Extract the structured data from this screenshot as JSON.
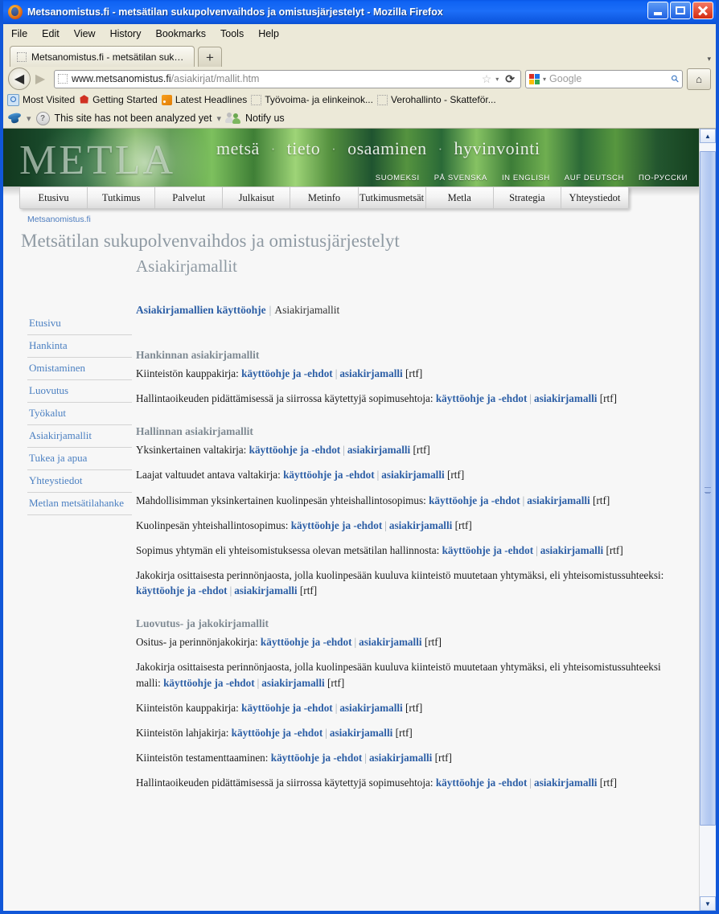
{
  "window": {
    "title": "Metsanomistus.fi - metsätilan sukupolvenvaihdos ja omistusjärjestelyt - Mozilla Firefox",
    "minimize_label": "Minimize",
    "maximize_label": "Maximize",
    "close_label": "Close"
  },
  "menubar": [
    "File",
    "Edit",
    "View",
    "History",
    "Bookmarks",
    "Tools",
    "Help"
  ],
  "tabs": {
    "active_tab_label": "Metsanomistus.fi - metsätilan suku...",
    "new_tab_label": "+",
    "tab_list_label": "▾"
  },
  "navbar": {
    "back_label": "◀",
    "forward_label": "▶",
    "url_main": "www.metsanomistus.fi",
    "url_path": "/asiakirjat/mallit.htm",
    "star_label": "☆",
    "star_caret": "▾",
    "reload_label": "⟳",
    "search_caret": "▾",
    "search_placeholder": "Google",
    "magnifier_label": "⚲",
    "home_label": "⌂"
  },
  "bookmarks": [
    {
      "label": "Most Visited",
      "icon": "most-visited-icon"
    },
    {
      "label": "Getting Started",
      "icon": "getting-started-icon"
    },
    {
      "label": "Latest Headlines",
      "icon": "rss-icon"
    },
    {
      "label": "Työvoima- ja elinkeinok...",
      "icon": "generic-bookmark-icon"
    },
    {
      "label": "Verohallinto - Skatteför...",
      "icon": "generic-bookmark-icon"
    }
  ],
  "statusbar": {
    "wot_caret": "▾",
    "message": "This site has not been analyzed yet",
    "separator": "▾",
    "notify_label": "Notify us"
  },
  "banner": {
    "logo": "METLA",
    "slogan_words": [
      "metsä",
      "tieto",
      "osaaminen",
      "hyvinvointi"
    ],
    "slogan_separator": "·",
    "languages": [
      "SUOMEKSI",
      "PÅ SVENSKA",
      "IN ENGLISH",
      "AUF DEUTSCH",
      "ПО-РУССКИ"
    ]
  },
  "sitenav": [
    "Etusivu",
    "Tutkimus",
    "Palvelut",
    "Julkaisut",
    "Metinfo",
    "Tutkimusmetsät",
    "Metla",
    "Strategia",
    "Yhteystiedot"
  ],
  "breadcrumb": "Metsanomistus.fi",
  "page_title": "Metsätilan sukupolvenvaihdos ja omistusjärjestelyt",
  "sidebar": {
    "items": [
      "Etusivu",
      "Hankinta",
      "Omistaminen",
      "Luovutus",
      "Työkalut",
      "Asiakirjamallit",
      "Tukea ja apua",
      "Yhteystiedot",
      "Metlan metsätilahanke"
    ]
  },
  "main": {
    "section_title": "Asiakirjamallit",
    "crumb": {
      "link": "Asiakirjamallien käyttöohje",
      "separator": "|",
      "current": "Asiakirjamallit"
    },
    "link_guide": "käyttöohje ja -ehdot",
    "link_model": "asiakirjamalli",
    "link_model_plural": "asiakirjamalli",
    "format": "[rtf]",
    "pipe": "|",
    "groups": [
      {
        "title": "Hankinnan asiakirjamallit",
        "documents": [
          {
            "label": "Kiinteistön kauppakirja:",
            "guide": "käyttöohje ja -ehdot",
            "model": "asiakirjamalli",
            "format": "[rtf]"
          },
          {
            "label": "Hallintaoikeuden pidättämisessä ja siirrossa käytettyjä sopimusehtoja:",
            "guide": "käyttöohje ja -ehdot",
            "model": "asiakirjamalli",
            "format": "[rtf]"
          }
        ]
      },
      {
        "title": "Hallinnan asiakirjamallit",
        "documents": [
          {
            "label": "Yksinkertainen valtakirja:",
            "guide": "käyttöohje ja -ehdot",
            "model": "asiakirjamalli",
            "format": "[rtf]"
          },
          {
            "label": "Laajat valtuudet antava valtakirja:",
            "guide": "käyttöohje ja -ehdot",
            "model": "asiakirjamalli",
            "format": "[rtf]"
          },
          {
            "label": "Mahdollisimman yksinkertainen kuolinpesän yhteishallintosopimus:",
            "guide": "käyttöohje ja -ehdot",
            "model": "asiakirjamalli",
            "format": "[rtf]"
          },
          {
            "label": "Kuolinpesän yhteishallintosopimus:",
            "guide": "käyttöohje ja -ehdot",
            "model": "asiakirjamalli",
            "format": "[rtf]"
          },
          {
            "label": "Sopimus yhtymän eli yhteisomistuksessa olevan metsätilan hallinnosta:",
            "guide": "käyttöohje ja -ehdot",
            "model": "asiakirjamalli",
            "format": "[rtf]"
          },
          {
            "label": "Jakokirja osittaisesta perinnönjaosta, jolla kuolinpesään kuuluva kiinteistö muutetaan yhtymäksi, eli yhteisomistussuhteeksi:",
            "guide": "käyttöohje ja -ehdot",
            "model": "asiakirjamalli",
            "format": "[rtf]"
          }
        ]
      },
      {
        "title": "Luovutus- ja jakokirjamallit",
        "documents": [
          {
            "label": "Ositus- ja perinnönjakokirja:",
            "guide": "käyttöohje ja -ehdot",
            "model": "asiakirjamalli",
            "format": "[rtf]"
          },
          {
            "label": "Jakokirja osittaisesta perinnönjaosta, jolla kuolinpesään kuuluva kiinteistö muutetaan yhtymäksi, eli yhteisomistussuhteeksi malli:",
            "guide": "käyttöohje ja -ehdot",
            "model": "asiakirjamalli",
            "format": "[rtf]"
          },
          {
            "label": "Kiinteistön kauppakirja:",
            "guide": "käyttöohje ja -ehdot",
            "model": "asiakirjamalli",
            "format": "[rtf]"
          },
          {
            "label": "Kiinteistön lahjakirja:",
            "guide": "käyttöohje ja -ehdot",
            "model": "asiakirjamalli",
            "format": "[rtf]"
          },
          {
            "label": "Kiinteistön testamenttaaminen:",
            "guide": "käyttöohje ja -ehdot",
            "model": "asiakirjamalli",
            "format": "[rtf]"
          },
          {
            "label": "Hallintaoikeuden pidättämisessä ja siirrossa käytettyjä sopimusehtoja:",
            "guide": "käyttöohje ja -ehdot",
            "model": "asiakirjamalli",
            "format": "[rtf]"
          }
        ]
      }
    ]
  },
  "scrollbar": {
    "up_label": "▲",
    "down_label": "▼"
  },
  "colors": {
    "titlebar_blue": "#1c6ef8",
    "chrome_tan": "#ece9d8",
    "link_blue": "#2d5fa6",
    "sidebar_link": "#4a7fc1",
    "heading_gray": "#8f9aa3",
    "banner_green": "#3f7f36"
  }
}
